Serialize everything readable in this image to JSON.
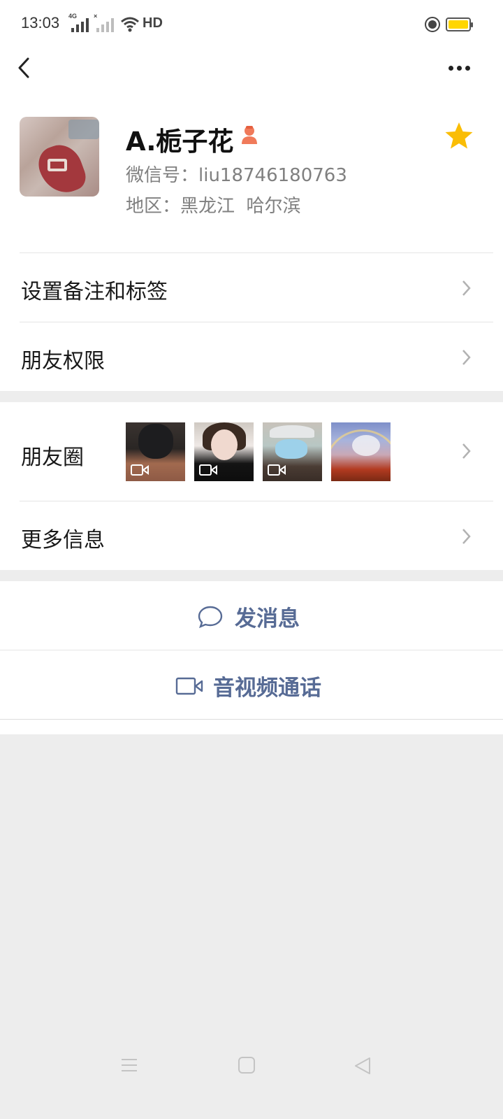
{
  "status_bar": {
    "time": "13:03",
    "signal1_label": "4G",
    "signal2_label": "×",
    "network": "HD",
    "icons": [
      "signal-icon",
      "signal-icon",
      "wifi-icon",
      "hd-icon",
      "screen-record-icon",
      "battery-icon"
    ]
  },
  "nav": {
    "back_icon": "chevron-left-icon",
    "more_icon": "more-dots-icon"
  },
  "profile": {
    "name": "A.栀子花",
    "gender_icon": "female-icon",
    "wechat_id": "微信号：liu18746180763",
    "region": "地区：黑龙江  哈尔滨",
    "star_icon": "star-icon",
    "star_color": "#fabd05"
  },
  "menu": {
    "remarks_label": "设置备注和标签",
    "permissions_label": "朋友权限",
    "moments_label": "朋友圈",
    "more_info_label": "更多信息"
  },
  "moments_thumbs": [
    {
      "type": "video",
      "desc": "woman in black mask"
    },
    {
      "type": "video",
      "desc": "woman portrait"
    },
    {
      "type": "video",
      "desc": "woman in blue mask"
    },
    {
      "type": "photo",
      "desc": "poppy field with rainbow"
    }
  ],
  "actions": {
    "message_label": "发消息",
    "call_label": "音视频通话",
    "accent_color": "#576b95"
  },
  "system_nav": {
    "icons": [
      "menu-icon",
      "home-icon",
      "back-triangle-icon"
    ]
  }
}
